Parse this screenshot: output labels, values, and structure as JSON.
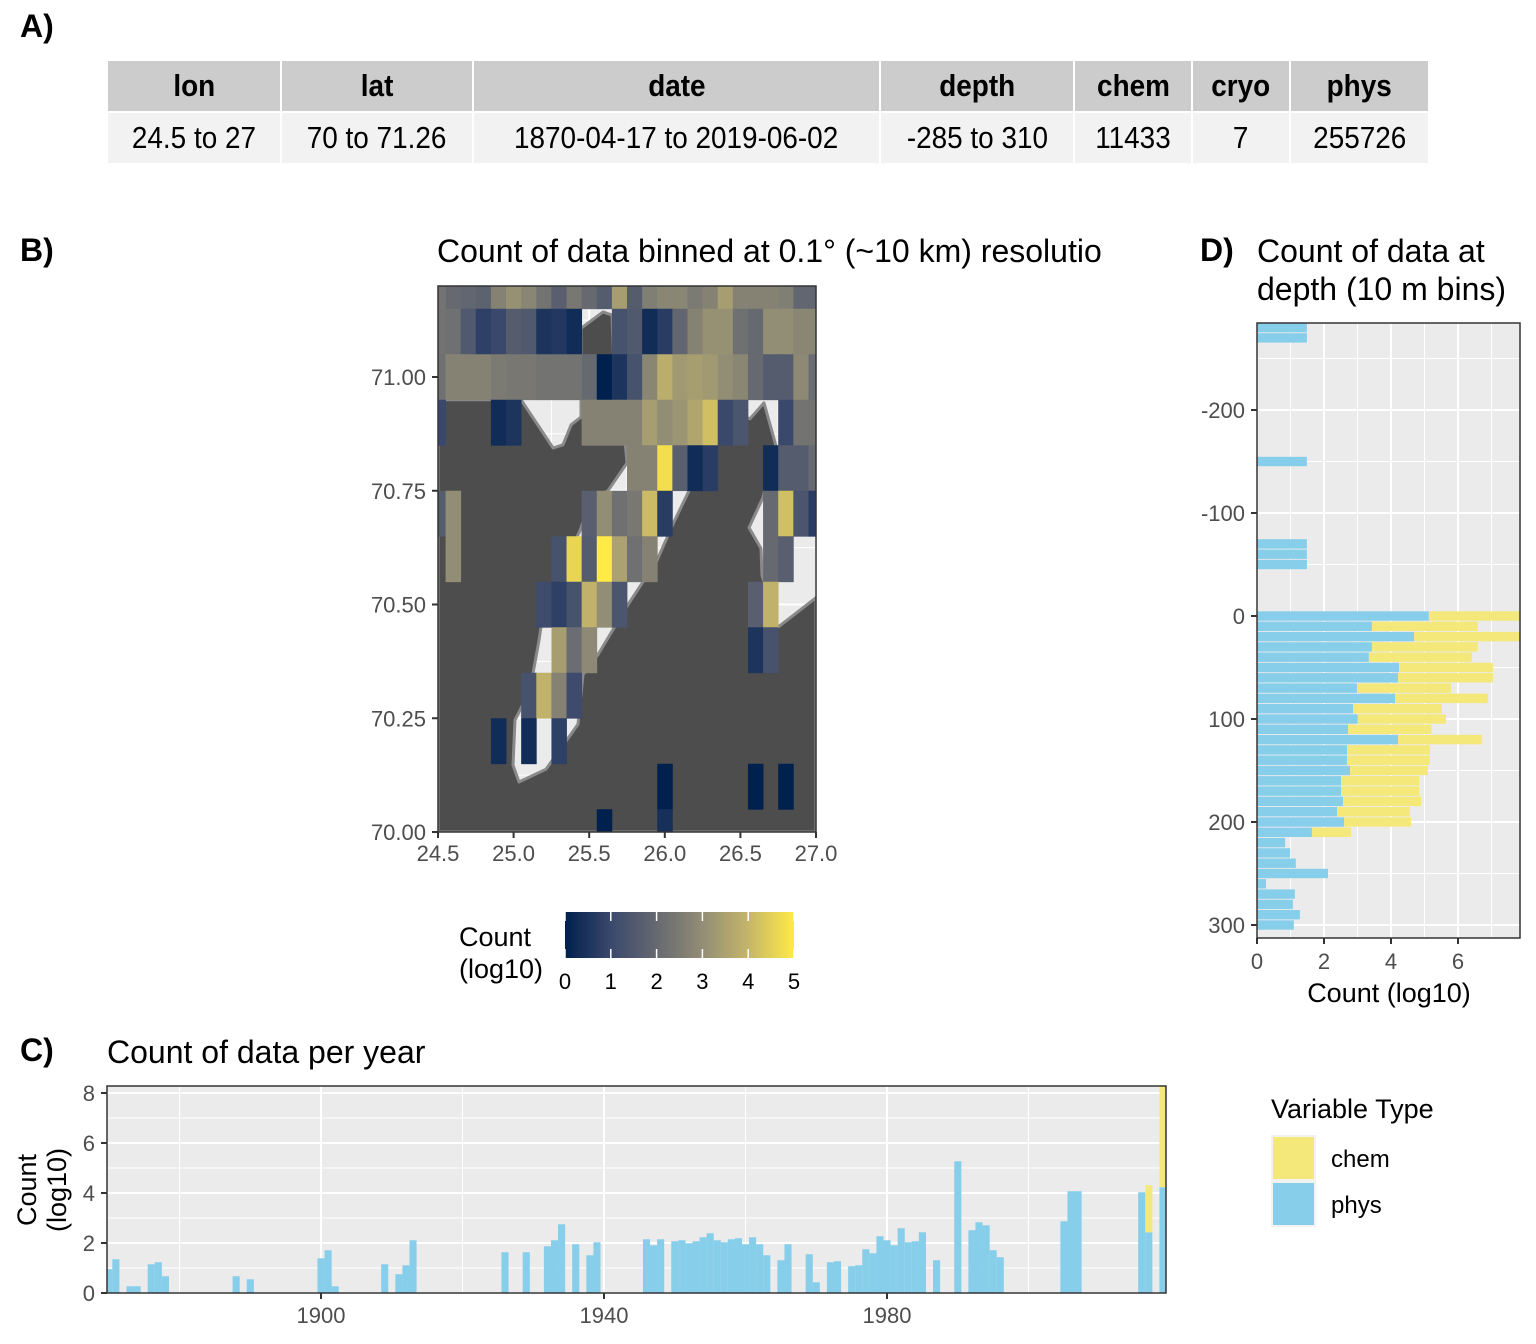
{
  "panels": {
    "a": "A)",
    "b": "B)",
    "c": "C)",
    "d": "D)"
  },
  "summary_table": {
    "headers": [
      "lon",
      "lat",
      "date",
      "depth",
      "chem",
      "cryo",
      "phys"
    ],
    "row": [
      "24.5 to 27",
      "70 to 71.26",
      "1870-04-17 to 2019-06-02",
      "-285 to 310",
      "11433",
      "7",
      "255726"
    ]
  },
  "colors": {
    "chem": "#F5E87A",
    "phys": "#87CEEB",
    "land": "#4D4D4D",
    "panel_bg": "#EBEBEB",
    "colormap": [
      "#00204D",
      "#3A486C",
      "#666970",
      "#928D75",
      "#C5B56A",
      "#FFEA46"
    ]
  },
  "chart_data": [
    {
      "panel": "B",
      "type": "heatmap",
      "title": "Count of data binned at 0.1° (~10 km) resolutio",
      "xlim": [
        24.5,
        27.0
      ],
      "ylim": [
        70.0,
        71.2
      ],
      "x_ticks": [
        "24.5",
        "25.0",
        "25.5",
        "26.0",
        "26.5",
        "27.0"
      ],
      "y_ticks": [
        "70.00",
        "70.25",
        "70.50",
        "70.75",
        "71.00"
      ],
      "grid": true,
      "legend": {
        "title_line1": "Count",
        "title_line2": "(log10)",
        "ticks": [
          "0",
          "1",
          "2",
          "3",
          "4",
          "5"
        ],
        "range": [
          0,
          5
        ],
        "placement": "bottom"
      },
      "lon": [
        24.5,
        24.6,
        24.7,
        24.8,
        24.9,
        25.0,
        25.1,
        25.2,
        25.3,
        25.4,
        25.5,
        25.6,
        25.7,
        25.8,
        25.9,
        26.0,
        26.1,
        26.2,
        26.3,
        26.4,
        26.5,
        26.6,
        26.7,
        26.8,
        26.9,
        27.0
      ],
      "lat": [
        71.2,
        71.1,
        71.0,
        70.9,
        70.8,
        70.7,
        70.6,
        70.5,
        70.4,
        70.3,
        70.2,
        70.1,
        70.0
      ],
      "values_log10": [
        [
          2.3,
          2.0,
          1.9,
          1.8,
          2.7,
          3.1,
          2.8,
          2.3,
          1.7,
          2.4,
          2.0,
          1.6,
          3.4,
          1.6,
          2.6,
          2.8,
          2.8,
          2.5,
          2.7,
          3.4,
          2.7,
          2.7,
          2.7,
          2.6,
          1.9,
          1.9
        ],
        [
          2.3,
          2.2,
          1.5,
          0.8,
          1.0,
          1.6,
          1.5,
          0.5,
          0.6,
          0.3,
          null,
          null,
          1.3,
          1.5,
          0.3,
          0.7,
          1.9,
          2.7,
          3.1,
          3.1,
          2.2,
          2.0,
          3.0,
          3.0,
          2.8,
          2.8
        ],
        [
          2.2,
          2.7,
          2.7,
          2.7,
          2.5,
          2.4,
          2.4,
          2.3,
          2.3,
          2.3,
          2.0,
          0.0,
          0.5,
          1.3,
          2.8,
          3.8,
          3.3,
          3.4,
          3.3,
          3.0,
          2.8,
          2.0,
          1.6,
          1.6,
          2.9,
          2.1
        ],
        [
          1.0,
          null,
          null,
          null,
          0.3,
          0.5,
          null,
          null,
          null,
          null,
          2.7,
          2.7,
          2.7,
          2.7,
          3.4,
          3.0,
          3.2,
          3.6,
          4.2,
          1.0,
          1.4,
          null,
          null,
          1.0,
          2.3,
          2.3
        ],
        [
          null,
          null,
          null,
          null,
          null,
          null,
          null,
          null,
          null,
          null,
          null,
          null,
          null,
          2.7,
          2.7,
          4.8,
          1.7,
          0.3,
          0.7,
          null,
          null,
          null,
          0.3,
          1.6,
          1.6,
          2.0
        ],
        [
          1.6,
          3.0,
          null,
          null,
          null,
          null,
          null,
          null,
          null,
          null,
          1.7,
          3.0,
          2.2,
          2.4,
          4.1,
          0.7,
          null,
          null,
          null,
          null,
          null,
          null,
          2.0,
          4.2,
          1.4,
          0.7
        ],
        [
          null,
          3.0,
          null,
          null,
          null,
          null,
          null,
          null,
          1.3,
          4.6,
          1.6,
          5.0,
          3.5,
          2.2,
          2.7,
          null,
          null,
          null,
          null,
          null,
          null,
          null,
          2.0,
          1.7,
          null,
          null
        ],
        [
          null,
          null,
          null,
          null,
          null,
          null,
          null,
          1.1,
          0.8,
          1.3,
          3.9,
          3.0,
          1.4,
          null,
          null,
          null,
          null,
          null,
          null,
          null,
          null,
          1.7,
          3.9,
          null,
          null,
          null
        ],
        [
          null,
          null,
          null,
          null,
          null,
          null,
          null,
          null,
          3.4,
          2.1,
          2.9,
          null,
          null,
          null,
          null,
          null,
          null,
          null,
          null,
          null,
          null,
          0.5,
          1.3,
          null,
          null,
          null
        ],
        [
          null,
          null,
          null,
          null,
          null,
          null,
          1.3,
          3.9,
          2.7,
          1.1,
          null,
          null,
          null,
          null,
          null,
          null,
          null,
          null,
          null,
          null,
          null,
          null,
          null,
          null,
          null,
          null
        ],
        [
          null,
          null,
          null,
          null,
          0.3,
          null,
          0.3,
          null,
          0.8,
          null,
          null,
          null,
          null,
          null,
          null,
          null,
          null,
          null,
          null,
          null,
          null,
          null,
          null,
          null,
          null,
          null
        ],
        [
          null,
          null,
          null,
          null,
          null,
          null,
          null,
          null,
          null,
          null,
          null,
          null,
          null,
          null,
          null,
          0.0,
          null,
          null,
          null,
          null,
          null,
          0.0,
          null,
          0.0,
          null,
          null
        ],
        [
          null,
          null,
          null,
          null,
          null,
          null,
          null,
          null,
          null,
          null,
          null,
          0.0,
          null,
          null,
          null,
          0.4,
          null,
          null,
          null,
          null,
          null,
          null,
          null,
          null,
          null,
          null
        ]
      ],
      "land_polygon_lonlat": [
        [
          24.5,
          70.0
        ],
        [
          27.0,
          70.0
        ],
        [
          27.0,
          70.515
        ],
        [
          26.749,
          70.45
        ],
        [
          26.696,
          70.509
        ],
        [
          26.643,
          70.564
        ],
        [
          26.636,
          70.623
        ],
        [
          26.557,
          70.669
        ],
        [
          26.649,
          70.735
        ],
        [
          26.735,
          70.849
        ],
        [
          26.656,
          70.943
        ],
        [
          26.563,
          70.908
        ],
        [
          26.464,
          70.925
        ],
        [
          26.365,
          70.947
        ],
        [
          26.233,
          70.838
        ],
        [
          26.16,
          70.75
        ],
        [
          26.048,
          70.673
        ],
        [
          25.948,
          70.596
        ],
        [
          25.856,
          70.55
        ],
        [
          25.757,
          70.5
        ],
        [
          25.558,
          70.39
        ],
        [
          25.459,
          70.346
        ],
        [
          25.426,
          70.237
        ],
        [
          25.347,
          70.2
        ],
        [
          25.214,
          70.138
        ],
        [
          25.036,
          70.11
        ],
        [
          24.996,
          70.147
        ],
        [
          25.009,
          70.246
        ],
        [
          25.108,
          70.311
        ],
        [
          25.168,
          70.421
        ],
        [
          25.208,
          70.509
        ],
        [
          25.439,
          70.662
        ],
        [
          25.505,
          70.728
        ],
        [
          25.624,
          70.75
        ],
        [
          25.75,
          70.811
        ],
        [
          25.737,
          70.86
        ],
        [
          25.671,
          70.947
        ],
        [
          25.651,
          71.136
        ],
        [
          25.591,
          71.143
        ],
        [
          25.446,
          71.107
        ],
        [
          25.446,
          70.912
        ],
        [
          25.38,
          70.895
        ],
        [
          25.327,
          70.851
        ],
        [
          25.261,
          70.844
        ],
        [
          25.049,
          70.95
        ],
        [
          24.5,
          70.95
        ]
      ]
    },
    {
      "panel": "C",
      "type": "bar",
      "stacked": true,
      "title": "Count of data per year",
      "ylabel_line1": "Count",
      "ylabel_line2": "(log10)",
      "xlim": [
        1869.5,
        2019.5
      ],
      "ylim": [
        0,
        8.28
      ],
      "x_ticks": [
        "1900",
        "1940",
        "1980"
      ],
      "y_ticks": [
        "0",
        "2",
        "4",
        "6",
        "8"
      ],
      "grid": true,
      "legend": {
        "title": "Variable Type",
        "entries": [
          "chem",
          "phys"
        ],
        "placement": "right"
      },
      "data": [
        {
          "year": 1870,
          "phys": 0.95
        },
        {
          "year": 1871,
          "phys": 1.35
        },
        {
          "year": 1873,
          "phys": 0.27
        },
        {
          "year": 1874,
          "phys": 0.27
        },
        {
          "year": 1876,
          "phys": 1.15
        },
        {
          "year": 1877,
          "phys": 1.23
        },
        {
          "year": 1878,
          "phys": 0.67
        },
        {
          "year": 1888,
          "phys": 0.67
        },
        {
          "year": 1890,
          "phys": 0.55
        },
        {
          "year": 1900,
          "phys": 1.39
        },
        {
          "year": 1901,
          "phys": 1.71
        },
        {
          "year": 1902,
          "phys": 0.27
        },
        {
          "year": 1909,
          "phys": 1.15
        },
        {
          "year": 1911,
          "phys": 0.75
        },
        {
          "year": 1912,
          "phys": 1.11
        },
        {
          "year": 1913,
          "phys": 2.11
        },
        {
          "year": 1926,
          "phys": 1.63
        },
        {
          "year": 1929,
          "phys": 1.63
        },
        {
          "year": 1932,
          "phys": 1.87
        },
        {
          "year": 1933,
          "phys": 2.11
        },
        {
          "year": 1934,
          "phys": 2.75
        },
        {
          "year": 1936,
          "phys": 1.95
        },
        {
          "year": 1938,
          "phys": 1.51
        },
        {
          "year": 1939,
          "phys": 2.03
        },
        {
          "year": 1946,
          "phys": 2.15
        },
        {
          "year": 1947,
          "phys": 1.91
        },
        {
          "year": 1948,
          "phys": 2.15
        },
        {
          "year": 1950,
          "phys": 2.07
        },
        {
          "year": 1951,
          "phys": 2.11
        },
        {
          "year": 1952,
          "phys": 1.99
        },
        {
          "year": 1953,
          "phys": 2.07
        },
        {
          "year": 1954,
          "phys": 2.23
        },
        {
          "year": 1955,
          "phys": 2.39
        },
        {
          "year": 1956,
          "phys": 2.11
        },
        {
          "year": 1957,
          "phys": 2.03
        },
        {
          "year": 1958,
          "phys": 2.15
        },
        {
          "year": 1959,
          "phys": 2.19
        },
        {
          "year": 1960,
          "phys": 1.95
        },
        {
          "year": 1961,
          "phys": 2.23
        },
        {
          "year": 1962,
          "phys": 1.95
        },
        {
          "year": 1963,
          "phys": 1.51
        },
        {
          "year": 1965,
          "phys": 1.31
        },
        {
          "year": 1966,
          "phys": 1.95
        },
        {
          "year": 1969,
          "phys": 1.55
        },
        {
          "year": 1970,
          "phys": 0.43
        },
        {
          "year": 1972,
          "phys": 1.23
        },
        {
          "year": 1973,
          "phys": 1.27
        },
        {
          "year": 1975,
          "phys": 1.07
        },
        {
          "year": 1976,
          "phys": 1.11
        },
        {
          "year": 1977,
          "phys": 1.75
        },
        {
          "year": 1978,
          "phys": 1.59
        },
        {
          "year": 1979,
          "phys": 2.27
        },
        {
          "year": 1980,
          "phys": 2.11
        },
        {
          "year": 1981,
          "phys": 1.91
        },
        {
          "year": 1982,
          "phys": 2.59
        },
        {
          "year": 1983,
          "phys": 2.03
        },
        {
          "year": 1984,
          "phys": 2.07
        },
        {
          "year": 1985,
          "phys": 2.43
        },
        {
          "year": 1987,
          "phys": 1.31
        },
        {
          "year": 1990,
          "phys": 5.27
        },
        {
          "year": 1992,
          "phys": 2.51
        },
        {
          "year": 1993,
          "phys": 2.83
        },
        {
          "year": 1994,
          "phys": 2.71
        },
        {
          "year": 1995,
          "phys": 1.71
        },
        {
          "year": 1996,
          "phys": 1.43
        },
        {
          "year": 2005,
          "phys": 2.87
        },
        {
          "year": 2006,
          "phys": 4.07
        },
        {
          "year": 2007,
          "phys": 4.07
        },
        {
          "year": 2016,
          "phys": 4.03
        },
        {
          "year": 2017,
          "phys": 2.43,
          "chem": 1.88
        },
        {
          "year": 2019,
          "phys": 4.23,
          "chem": 4.04
        }
      ]
    },
    {
      "panel": "D",
      "type": "bar",
      "orientation": "horizontal",
      "stacked": true,
      "title_line1": "Count of data at",
      "title_line2": "depth (10 m bins)",
      "xlabel": "Count (log10)",
      "xlim": [
        0,
        7.85
      ],
      "ylim": [
        312,
        -285
      ],
      "x_ticks": [
        "0",
        "2",
        "4",
        "6"
      ],
      "y_ticks": [
        "-200",
        "-100",
        "0",
        "100",
        "200",
        "300"
      ],
      "grid": true,
      "data": [
        {
          "depth": -280,
          "phys": 1.49
        },
        {
          "depth": -270,
          "phys": 1.49
        },
        {
          "depth": -150,
          "phys": 1.49
        },
        {
          "depth": -70,
          "phys": 1.49
        },
        {
          "depth": -60,
          "phys": 1.49
        },
        {
          "depth": -50,
          "phys": 1.49
        },
        {
          "depth": 0,
          "phys": 5.13,
          "chem": 2.72
        },
        {
          "depth": 10,
          "phys": 3.43,
          "chem": 3.16
        },
        {
          "depth": 20,
          "phys": 4.69,
          "chem": 3.16
        },
        {
          "depth": 30,
          "phys": 3.43,
          "chem": 3.16
        },
        {
          "depth": 40,
          "phys": 3.34,
          "chem": 3.07
        },
        {
          "depth": 50,
          "phys": 4.24,
          "chem": 2.8
        },
        {
          "depth": 60,
          "phys": 4.21,
          "chem": 2.83
        },
        {
          "depth": 70,
          "phys": 2.99,
          "chem": 2.8
        },
        {
          "depth": 80,
          "phys": 4.12,
          "chem": 2.77
        },
        {
          "depth": 90,
          "phys": 2.87,
          "chem": 2.65
        },
        {
          "depth": 100,
          "phys": 3.01,
          "chem": 2.63
        },
        {
          "depth": 110,
          "phys": 2.72,
          "chem": 2.49
        },
        {
          "depth": 120,
          "phys": 4.21,
          "chem": 2.51
        },
        {
          "depth": 130,
          "phys": 2.69,
          "chem": 2.47
        },
        {
          "depth": 140,
          "phys": 2.69,
          "chem": 2.47
        },
        {
          "depth": 150,
          "phys": 2.78,
          "chem": 2.32
        },
        {
          "depth": 160,
          "phys": 2.51,
          "chem": 2.33
        },
        {
          "depth": 170,
          "phys": 2.51,
          "chem": 2.33
        },
        {
          "depth": 180,
          "phys": 2.57,
          "chem": 2.33
        },
        {
          "depth": 190,
          "phys": 2.39,
          "chem": 2.18
        },
        {
          "depth": 200,
          "phys": 2.6,
          "chem": 2.0
        },
        {
          "depth": 210,
          "phys": 1.64,
          "chem": 1.17
        },
        {
          "depth": 220,
          "phys": 0.84
        },
        {
          "depth": 230,
          "phys": 0.99
        },
        {
          "depth": 240,
          "phys": 1.16
        },
        {
          "depth": 250,
          "phys": 2.12
        },
        {
          "depth": 260,
          "phys": 0.27
        },
        {
          "depth": 270,
          "phys": 1.13
        },
        {
          "depth": 280,
          "phys": 1.07
        },
        {
          "depth": 290,
          "phys": 1.28
        },
        {
          "depth": 300,
          "phys": 1.1
        }
      ]
    }
  ]
}
